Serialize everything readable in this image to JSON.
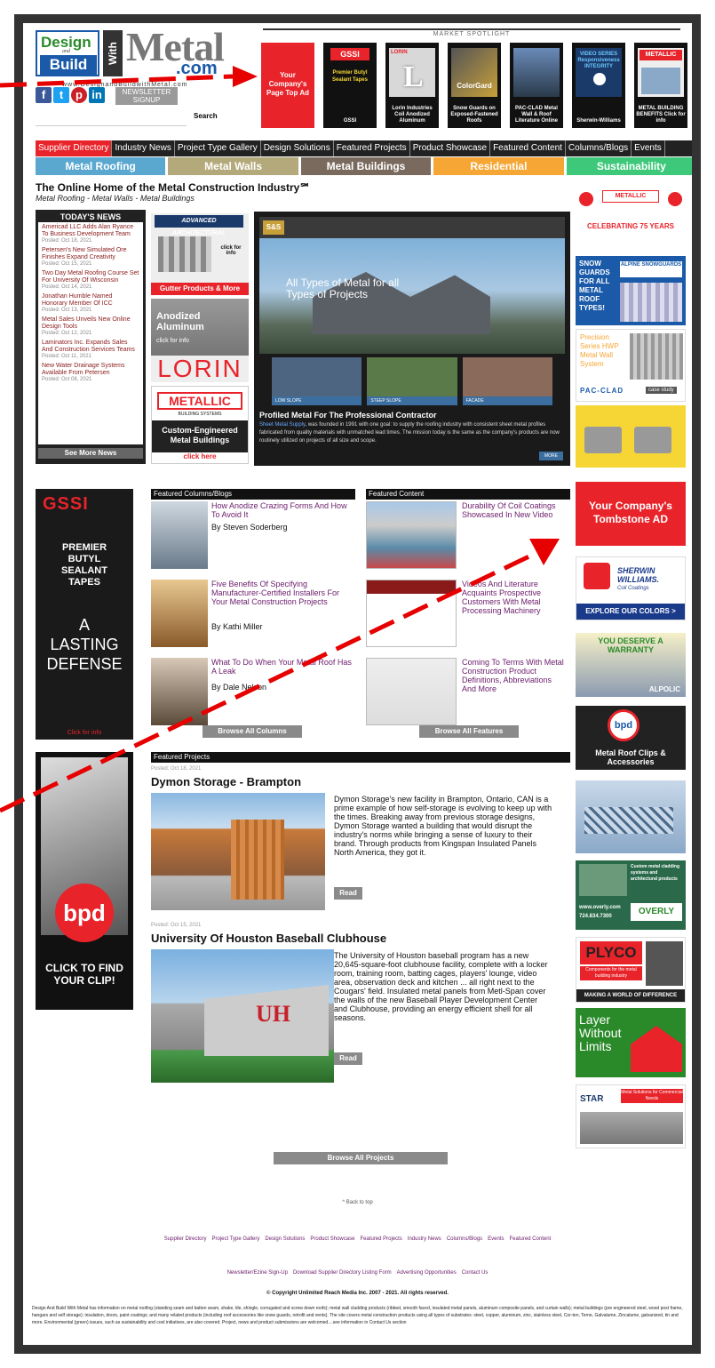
{
  "site": {
    "url": "www.DesignandBuildwithMetal.com",
    "logo_design": "Design",
    "logo_and": "and",
    "logo_build": "Build",
    "logo_with": "With",
    "logo_metal": "Metal",
    "logo_com": ".com"
  },
  "header": {
    "newsletter": "NEWSLETTER SIGNUP",
    "search_button": "Search",
    "search_placeholder": "",
    "market_spotlight": "MARKET SPOTLIGHT"
  },
  "spotlight": [
    {
      "caption": "Your Company's Page Top Ad"
    },
    {
      "caption": "GSSI",
      "art": "Premier Butyl Sealant Tapes"
    },
    {
      "caption": "Lorin Industries Coil Anodized Aluminum",
      "art": "LORIN"
    },
    {
      "caption": "Snow Guards on Exposed-Fastened Roofs",
      "art": "ColorGard"
    },
    {
      "caption": "PAC-CLAD Metal Wall & Roof Literature Online",
      "art": "PAC-CLAD"
    },
    {
      "caption": "Sherwin-Williams",
      "art": "VIDEO SERIES Responsiveness INTEGRITY"
    },
    {
      "caption": "METAL BUILDING BENEFITS Click for info",
      "art": "METALLIC"
    }
  ],
  "nav": [
    "Supplier Directory",
    "Industry News",
    "Project Type Gallery",
    "Design Solutions",
    "Featured Projects",
    "Product Showcase",
    "Featured Content",
    "Columns/Blogs",
    "Events"
  ],
  "categories": [
    {
      "label": "Metal Roofing",
      "color": "#5aa8d0"
    },
    {
      "label": "Metal Walls",
      "color": "#b4a97a"
    },
    {
      "label": "Metal Buildings",
      "color": "#7a6a5e"
    },
    {
      "label": "Residential",
      "color": "#f6a634"
    },
    {
      "label": "Sustainability",
      "color": "#3ec87a"
    }
  ],
  "intro": {
    "headline": "The Online Home of the Metal Construction Industry℠",
    "subhead": "Metal Roofing - Metal Walls - Metal Buildings"
  },
  "news": {
    "heading": "TODAY'S NEWS",
    "more": "See More News",
    "items": [
      {
        "title": "Americad LLC Adds Alan Ryance To Business Development Team",
        "date": "Posted: Oct 18, 2021"
      },
      {
        "title": "Petersen's New Simulated Ore Finishes Expand Creativity",
        "date": "Posted: Oct 15, 2021"
      },
      {
        "title": "Two Day Metal Roofing Course Set For University Of Wisconsin",
        "date": "Posted: Oct 14, 2021"
      },
      {
        "title": "Jonathan Humble Named Honorary Member Of ICC",
        "date": "Posted: Oct 13, 2021"
      },
      {
        "title": "Metal Sales Unveils New Online Design Tools",
        "date": "Posted: Oct 12, 2021"
      },
      {
        "title": "Laminators Inc. Expands Sales And Construction Services Teams",
        "date": "Posted: Oct 11, 2021"
      },
      {
        "title": "New Water Drainage Systems Available From Petersen",
        "date": "Posted: Oct 08, 2021"
      }
    ]
  },
  "side_ads": {
    "advanced": {
      "title": "ADVANCED ARCHITECTURAL",
      "sub": "click for info",
      "foot": "Gutter Products & More"
    },
    "lorin": {
      "title": "Anodized Aluminum",
      "sub": "click for info",
      "brand": "LORIN"
    },
    "metallic": {
      "brand": "METALLIC",
      "sub": "BUILDING SYSTEMS",
      "foot": "Custom-Engineered Metal Buildings",
      "click": "click here"
    }
  },
  "hero": {
    "logo": "S&S",
    "tagline": "All Types of Metal for all Types of Projects",
    "thumbs": [
      "LOW SLOPE",
      "STEEP SLOPE",
      "FACADE"
    ],
    "title": "Profiled Metal For The Professional Contractor",
    "link": "Sheet Metal Supply",
    "desc": ", was founded in 1991 with one goal: to supply the roofing industry with consistent sheet metal profiles fabricated from quality materials with unmatched lead times. The mission today is the same as the company's products are now routinely utilized on projects of all size and scope.",
    "more": "MORE"
  },
  "right_ads": [
    {
      "text": "CELEBRATING 75 YEARS",
      "brand": "METALLIC"
    },
    {
      "text": "SNOW GUARDS FOR ALL METAL ROOF TYPES!",
      "brand": "ALPINE SNOWGUARDS"
    },
    {
      "text": "Precision Series HWP Metal Wall System",
      "brand": "PAC-CLAD",
      "tag": "case study"
    },
    {
      "text": ""
    },
    {
      "text": "Your Company's Tombstone AD"
    },
    {
      "text": "EXPLORE OUR COLORS >",
      "brand": "SHERWIN WILLIAMS.",
      "sub": "Coil Coatings"
    },
    {
      "text": "YOU DESERVE A WARRANTY",
      "brand": "ALPOLIC"
    },
    {
      "text": "Metal Roof Clips & Accessories",
      "brand": "bpd"
    },
    {
      "text": ""
    },
    {
      "text": "Custom metal cladding systems and architectural products",
      "brand": "OVERLY",
      "phone": "724.834.7300",
      "url": "www.overly.com"
    },
    {
      "text": "MAKING A WORLD OF DIFFERENCE",
      "brand": "PLYCO",
      "sub": "Components for the metal building industry"
    },
    {
      "text": "Layer Without Limits"
    },
    {
      "text": "Metal Solutions for Commercial Needs",
      "brand": "STAR"
    }
  ],
  "gssi_ad": {
    "brand": "GSSI",
    "line1": "PREMIER BUTYL SEALANT TAPES",
    "line2": "A LASTING DEFENSE",
    "foot": "Click for info"
  },
  "bpd_ad": {
    "brand": "bpd",
    "foot": "CLICK TO FIND YOUR CLIP!"
  },
  "columns": {
    "heading": "Featured Columns/Blogs",
    "items": [
      {
        "title": "How Anodize Crazing Forms And How To Avoid It",
        "author": "By Steven Soderberg"
      },
      {
        "title": "Five Benefits Of Specifying Manufacturer-Certified Installers For Your Metal Construction Projects",
        "author": "By Kathi Miller"
      },
      {
        "title": "What To Do When Your Metal Roof Has A Leak",
        "author": "By Dale Nelson"
      }
    ],
    "browse": "Browse All Columns"
  },
  "content": {
    "heading": "Featured Content",
    "items": [
      {
        "title": "Durability Of Coil Coatings Showcased In New Video"
      },
      {
        "title": "Videos And Literature Acquaints Prospective Customers With Metal Processing Machinery"
      },
      {
        "title": "Coming To Terms With Metal Construction Product Definitions, Abbreviations And More"
      }
    ],
    "browse": "Browse All Features"
  },
  "projects": {
    "heading": "Featured Projects",
    "items": [
      {
        "date": "Posted: Oct 18, 2021",
        "title": "Dymon Storage - Brampton",
        "text": "Dymon Storage's new facility in Brampton, Ontario, CAN is a prime example of how self-storage is evolving to keep up with the times. Breaking away from previous storage designs, Dymon Storage wanted a building that would disrupt the industry's norms while bringing a sense of luxury to their brand. Through products from Kingspan Insulated Panels North America, they got it.",
        "read": "Read"
      },
      {
        "date": "Posted: Oct 15, 2021",
        "title": "University Of Houston Baseball Clubhouse",
        "text": "The University of Houston baseball program has a new 20,645-square-foot clubhouse facility, complete with a locker room, training room, batting cages, players' lounge, video area, observation deck and kitchen ... all right next to the Cougars' field. Insulated metal panels from Metl-Span cover the walls of the new Baseball Player Development Center and Clubhouse, providing an energy efficient shell for all seasons.",
        "read": "Read"
      }
    ],
    "browse": "Browse All Projects"
  },
  "footer": {
    "back": "^ Back to top",
    "links1": [
      "Supplier Directory",
      "Project Type Gallery",
      "Design Solutions",
      "Product Showcase",
      "Featured Projects",
      "Industry News",
      "Columns/Blogs",
      "Events",
      "Featured Content"
    ],
    "links2": [
      "Newsletter/Ezine Sign-Up",
      "Download Supplier Directory Listing Form",
      "Advertising Opportunities",
      "Contact Us"
    ],
    "copyright": "© Copyright Unlimited Reach Media Inc. 2007 - 2021. All rights reserved.",
    "about": "Design And Build With Metal has information on metal roofing (standing seam and batten seam, shake, tile, shingle, corrugated and screw down roofs); metal wall cladding products (ribbed, smooth faced, insulated metal panels, aluminum composite panels, and curtain walls); metal buildings (pre engineered steel, wood post frame, hangars and self storage); insulation, doors, paint coatings; and many related products (including roof accessories like snow guards, retrofit and vents). The site covers metal construction products using all types of substrates: steel, copper, aluminum, zinc, stainless steel, Cor-ten, Terne, Galvalume, Zincalume, galvanized, tin and more. Environmental (green) issues, such as sustainability and cool initiatives, are also covered. Project, news and product submissions are welcomed....see information in Contact Us section"
  },
  "colors": {
    "accent_red": "#e8232a",
    "dark": "#222222",
    "link_purple": "#6a1b6a",
    "annotation_red": "#e60000"
  }
}
